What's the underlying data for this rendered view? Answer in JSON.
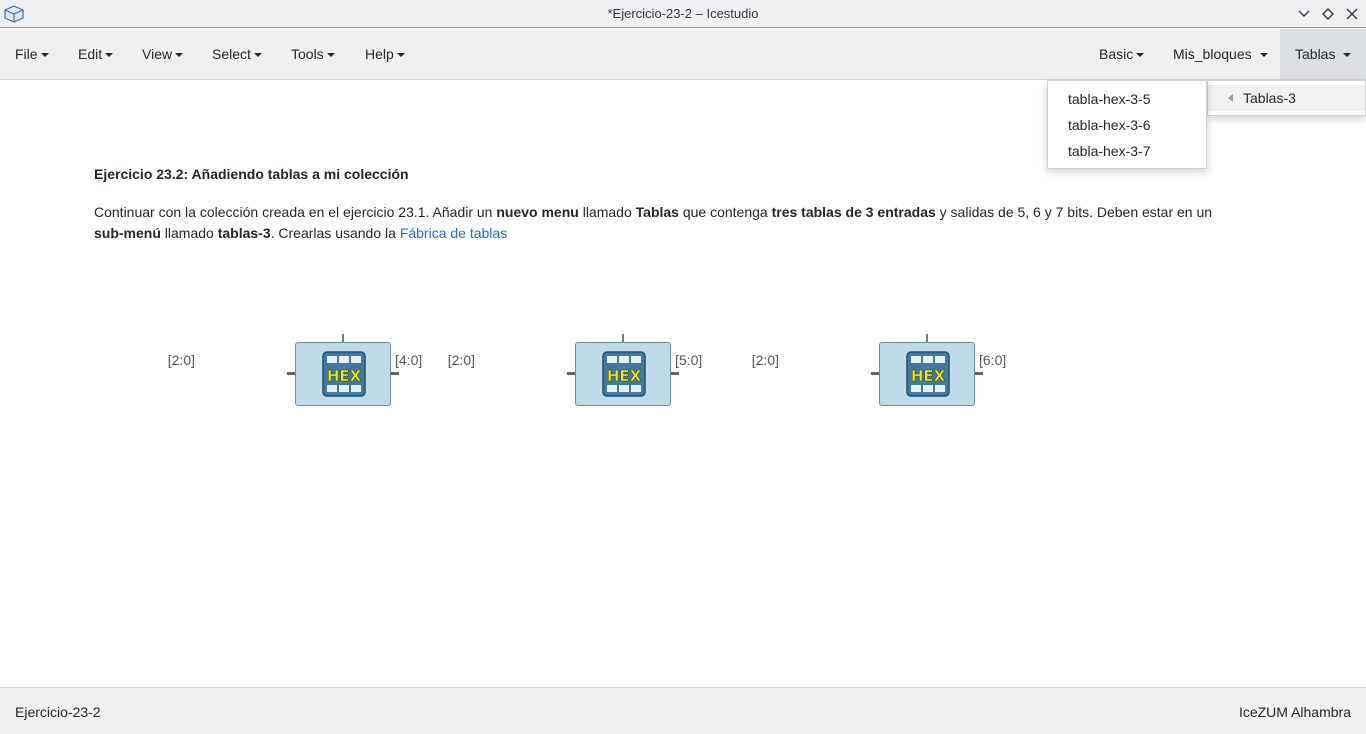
{
  "window": {
    "title": "*Ejercicio-23-2 – Icestudio"
  },
  "menubar": {
    "left": [
      {
        "label": "File"
      },
      {
        "label": "Edit"
      },
      {
        "label": "View"
      },
      {
        "label": "Select"
      },
      {
        "label": "Tools"
      },
      {
        "label": "Help"
      }
    ],
    "right": [
      {
        "label": "Basic"
      },
      {
        "label": "Mis_bloques"
      },
      {
        "label": "Tablas"
      }
    ]
  },
  "tablas_menu": {
    "submenu_label": "Tablas-3",
    "items": [
      "tabla-hex-3-5",
      "tabla-hex-3-6",
      "tabla-hex-3-7"
    ]
  },
  "document": {
    "heading": "Ejercicio 23.2: Añadiendo tablas a mi colección",
    "para": {
      "t1": "Continuar con la colección creada en el ejercicio 23.1. Añadir un ",
      "b1": "nuevo menu",
      "t2": " llamado ",
      "b2": "Tablas",
      "t3": " que contenga ",
      "b3": "tres tablas de 3 entradas",
      "t4": " y salidas de 5, 6 y 7 bits. Deben estar en un ",
      "b4": "sub-menú",
      "t5": " llamado ",
      "b5": "tablas-3",
      "t6": ". Crearlas usando la ",
      "link": "Fábrica de tablas"
    }
  },
  "blocks": [
    {
      "input": "[2:0]",
      "output": "[4:0]",
      "icon_text": "HEX"
    },
    {
      "input": "[2:0]",
      "output": "[5:0]",
      "icon_text": "HEX"
    },
    {
      "input": "[2:0]",
      "output": "[6:0]",
      "icon_text": "HEX"
    }
  ],
  "statusbar": {
    "left": "Ejercicio-23-2",
    "right": "IceZUM Alhambra"
  },
  "colors": {
    "accent": "#3daee9",
    "block_fill": "#bfdbe8",
    "hex_icon": "#3f7aa3",
    "hex_text": "#f5e61b",
    "link": "#1a6fc4"
  }
}
